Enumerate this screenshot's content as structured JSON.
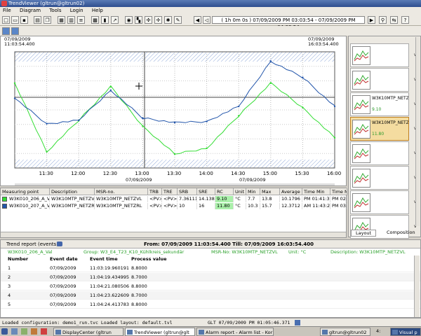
{
  "window": {
    "title": "TrendViewer (gltrun@gltrun02)"
  },
  "menu": [
    "File",
    "Diagram",
    "Tools",
    "Login",
    "Help"
  ],
  "toolbar": {
    "time_range": "( 1h 0m 0s ) 07/09/2009 PM 03:03:54 - 07/09/2009 PM 04:03:54"
  },
  "chart": {
    "start_date": "07/09/2009",
    "start_time": "11:03:54.400",
    "end_date": "07/09/2009",
    "end_time": "16:03:54.400",
    "x_ticks": [
      "11:30",
      "12:00",
      "12:30",
      "13:00",
      "13:30",
      "14:00",
      "14:30",
      "15:00",
      "15:30",
      "16:00"
    ],
    "x_date_1": "07/09/2009",
    "x_date_2": "07/09/2009",
    "colors": {
      "series1": "#33dd33",
      "series2": "#2255aa"
    }
  },
  "chart_data": {
    "type": "line",
    "x": [
      "11:03",
      "11:30",
      "12:00",
      "12:30",
      "13:00",
      "13:30",
      "14:00",
      "14:30",
      "15:00",
      "15:30",
      "16:00"
    ],
    "series": [
      {
        "name": "W3K010_206_A_Val",
        "values": [
          13.8,
          7.9,
          10.6,
          13.5,
          10.1,
          7.7,
          8.2,
          11.0,
          13.8,
          11.7,
          9.1
        ]
      },
      {
        "name": "W3K010_207_A_Val",
        "values": [
          12.5,
          10.3,
          10.6,
          13.2,
          10.8,
          10.4,
          10.5,
          11.8,
          15.7,
          14.3,
          11.8
        ]
      }
    ],
    "grid": true
  },
  "table": {
    "headers": [
      "Measuring point",
      "Description",
      "MSR-no.",
      "TRB",
      "TRE",
      "SRB",
      "SRE",
      "RC",
      "Unit",
      "Min",
      "Max",
      "Average",
      "Time Min",
      "Time M"
    ],
    "rows": [
      [
        "W3K010_206_A_Val",
        "W3K10MTP_NETZVL",
        "W3K10MTP_NETZVL",
        "<PV>",
        "<PV>",
        "7.36111",
        "14.1389",
        "9.10",
        "°C",
        "7.7",
        "13.8",
        "10.1796",
        "PM 01:41:37",
        "PM 02:4"
      ],
      [
        "W3K010_207_A_Val",
        "W3K10MTP_NETZRL",
        "W3K10MTP_NETZRL",
        "<PV>",
        "<PV>",
        "10",
        "16",
        "11.80",
        "°C",
        "10.3",
        "15.7",
        "12.3712",
        "AM 11:43:27",
        "PM 03:4"
      ]
    ]
  },
  "side_panel": {
    "thumbs": [
      {
        "name": "",
        "value": "",
        "right": "v"
      },
      {
        "name": "",
        "value": "",
        "right": "v"
      },
      {
        "name": "W3K10MTP_NETZVL",
        "value": "9.10",
        "right": "v"
      },
      {
        "name": "W3K10MTP_NETZRL",
        "value": "11.80",
        "right": "v"
      },
      {
        "name": "",
        "value": "",
        "right": "v"
      },
      {
        "name": "",
        "value": "",
        "right": "v"
      },
      {
        "name": "",
        "value": "",
        "right": "v"
      },
      {
        "name": "",
        "value": "",
        "right": "v"
      }
    ],
    "tabs": [
      "Layout",
      "Composition"
    ]
  },
  "events": {
    "title": "Trend report (events)",
    "range_label": "From: 07/09/2009 11:03:54.400 Till: 07/09/2009 16:03:54.400",
    "info": [
      "W3K010_206_A_Val",
      "Group: W3_E4_T23_K10_Kühlkreis_sekundär",
      "MSR-No: W3K10MTP_NETZVL",
      "Unit: °C",
      "Description: W3K10MTP_NETZVL"
    ],
    "columns": [
      "Number",
      "Event date",
      "Event time",
      "Process value"
    ],
    "rows": [
      [
        "1",
        "07/09/2009",
        "11:03:19.960191",
        "8.8000"
      ],
      [
        "2",
        "07/09/2009",
        "11:04:19.434995",
        "8.7000"
      ],
      [
        "3",
        "07/09/2009",
        "11:04:21.080506",
        "8.8000"
      ],
      [
        "4",
        "07/09/2009",
        "11:04:23.622609",
        "8.7000"
      ],
      [
        "5",
        "07/09/2009",
        "11:04:24.413783",
        "8.8000"
      ]
    ]
  },
  "status": {
    "left": "Loaded configuration: demo1_run.tvc Loaded layout: default.tvl",
    "right": "GLT 07/09/2009 PM 01:05:46.371"
  },
  "taskbar": {
    "items": [
      "DisplayCenter (gltrun",
      "TrendViewer (gltrun@glt",
      "Alarm report - Alarm list - Kor",
      "gltrun@gltrun02",
      "Visual p"
    ],
    "clock": "4:"
  }
}
